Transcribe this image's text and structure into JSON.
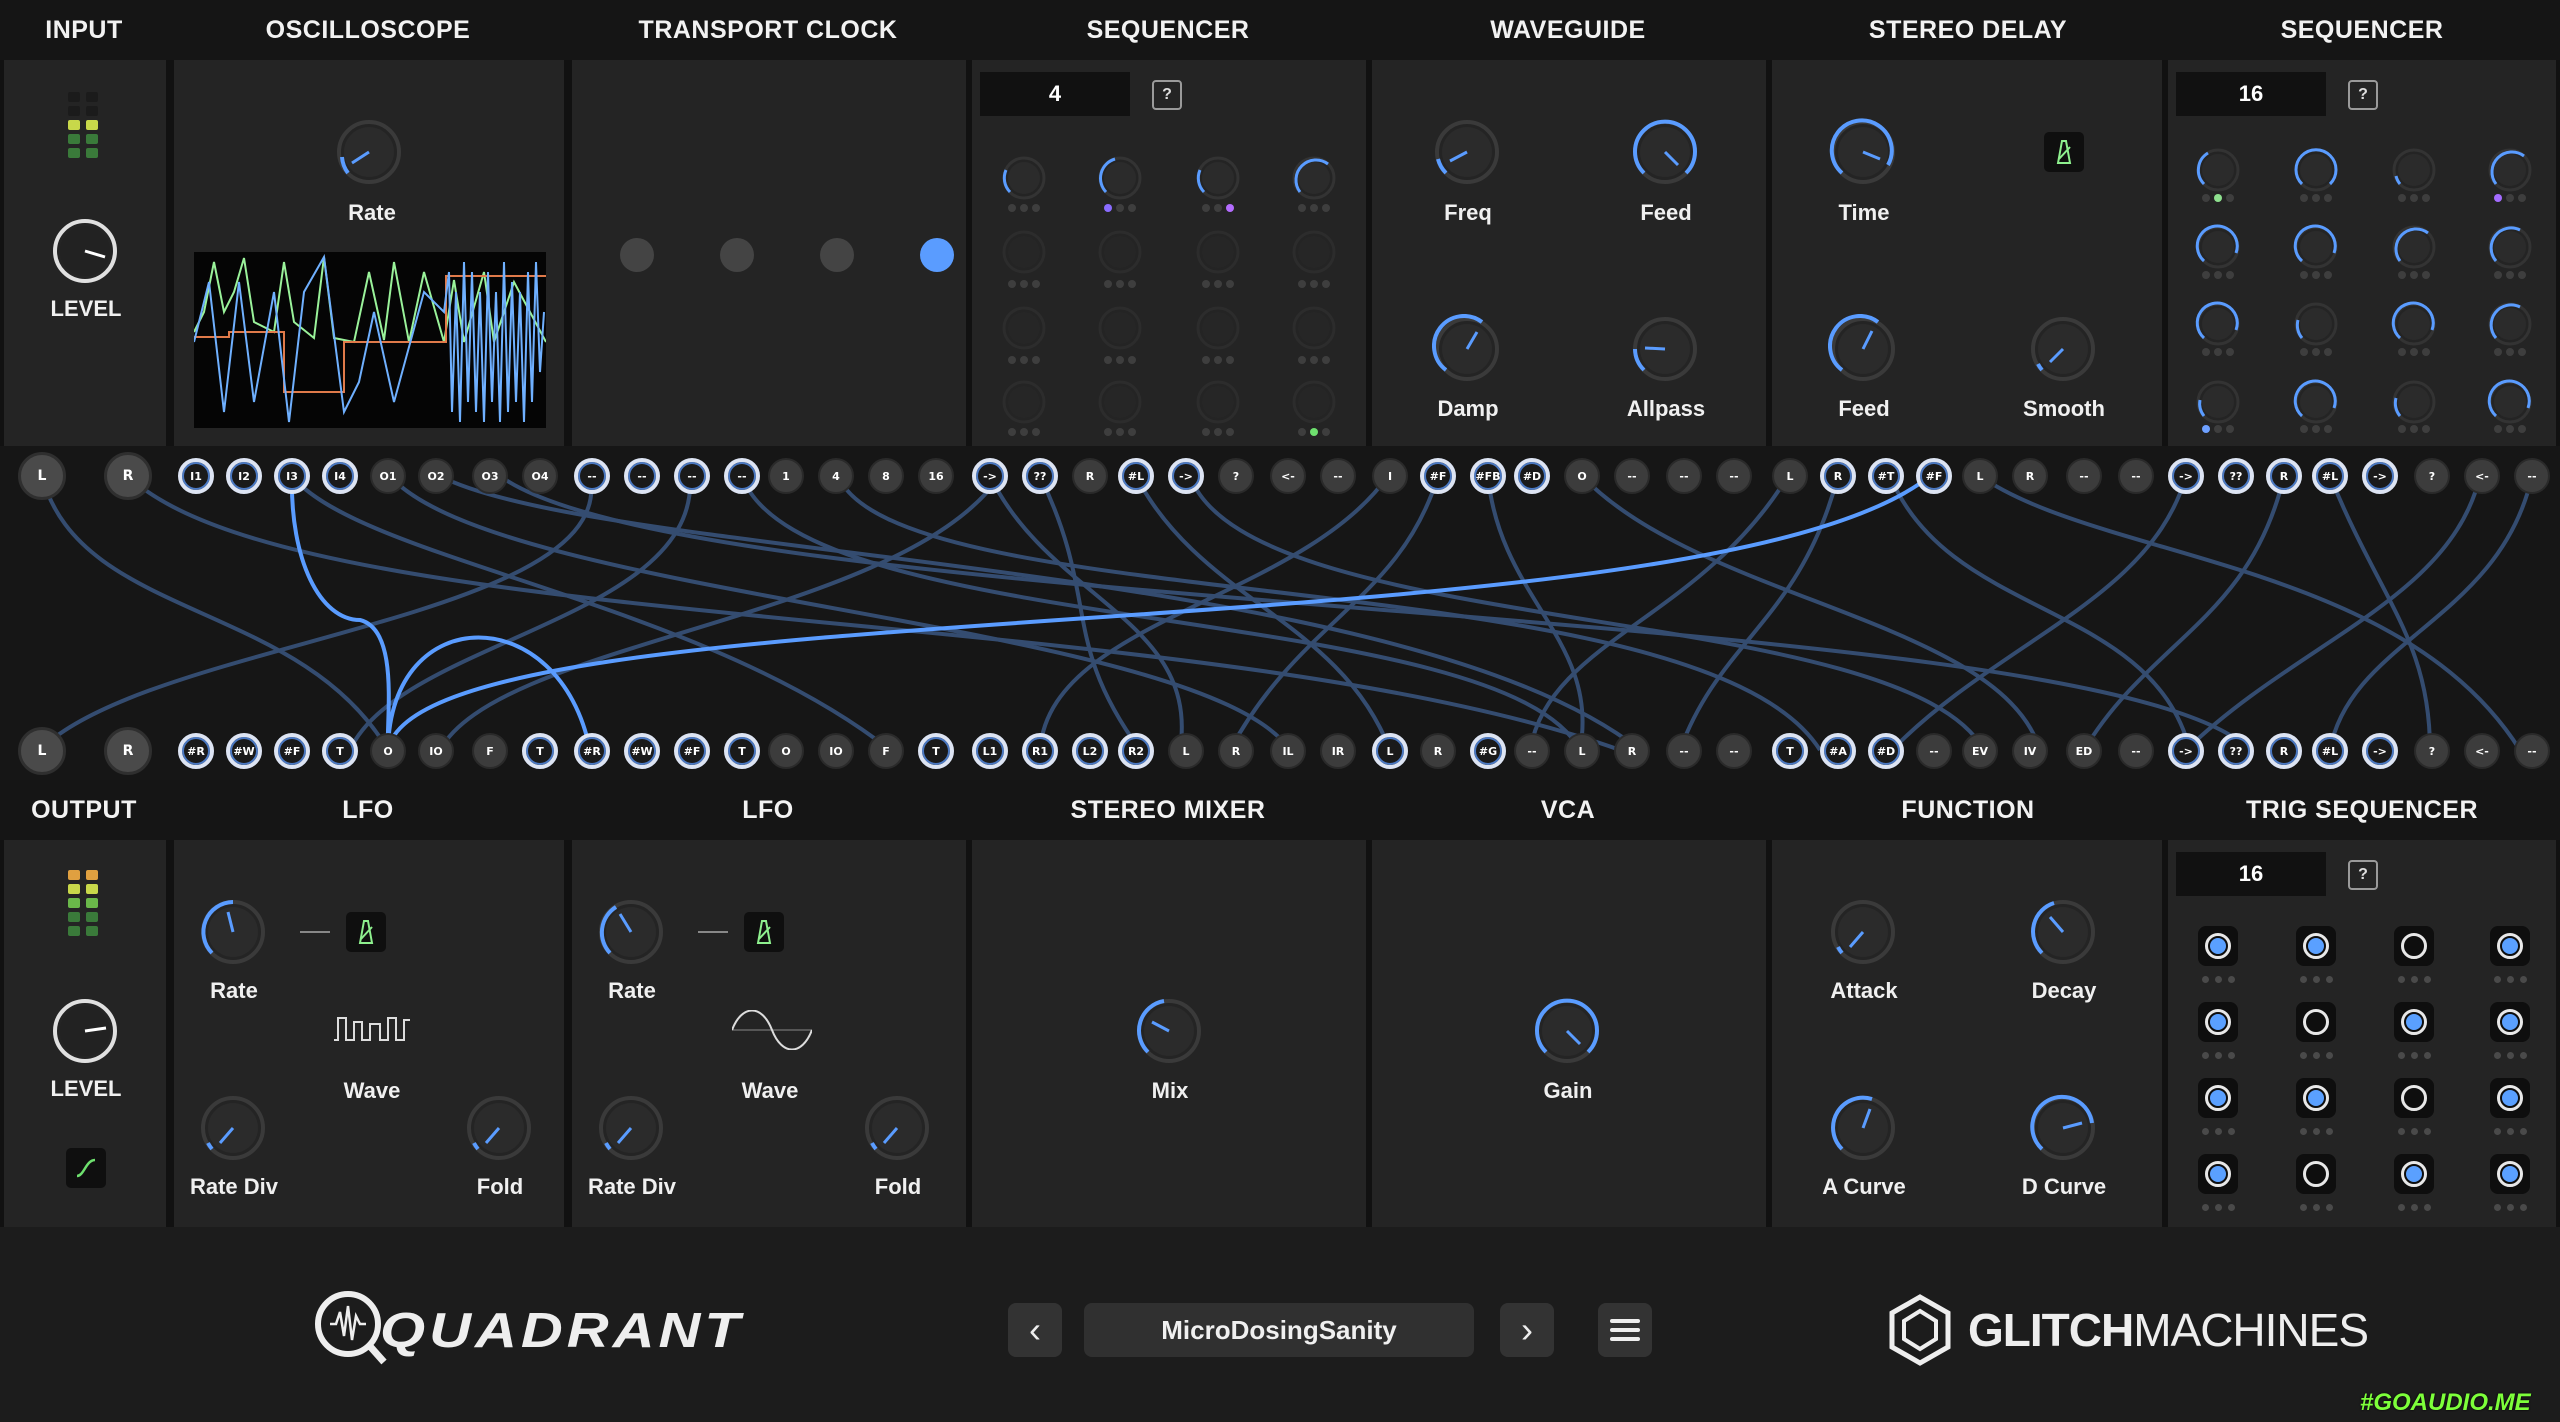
{
  "top_modules": [
    "INPUT",
    "OSCILLOSCOPE",
    "TRANSPORT CLOCK",
    "SEQUENCER",
    "WAVEGUIDE",
    "STEREO DELAY",
    "SEQUENCER"
  ],
  "bottom_modules": [
    "OUTPUT",
    "LFO",
    "LFO",
    "STEREO MIXER",
    "VCA",
    "FUNCTION",
    "TRIG SEQUENCER"
  ],
  "input": {
    "level_label": "LEVEL"
  },
  "output": {
    "level_label": "LEVEL"
  },
  "oscilloscope": {
    "rate_label": "Rate"
  },
  "sequencer1": {
    "steps": "4",
    "help": "?"
  },
  "sequencer2": {
    "steps": "16",
    "help": "?"
  },
  "trig_sequencer": {
    "steps": "16",
    "help": "?"
  },
  "waveguide": {
    "knobs": [
      "Freq",
      "Feed",
      "Damp",
      "Allpass"
    ]
  },
  "stereo_delay": {
    "knobs": [
      "Time",
      "Feed",
      "Smooth"
    ]
  },
  "lfo1": {
    "rate": "Rate",
    "wave": "Wave",
    "rate_div": "Rate Div",
    "fold": "Fold"
  },
  "lfo2": {
    "rate": "Rate",
    "wave": "Wave",
    "rate_div": "Rate Div",
    "fold": "Fold"
  },
  "stereo_mixer": {
    "mix": "Mix"
  },
  "vca": {
    "gain": "Gain"
  },
  "function": {
    "attack": "Attack",
    "decay": "Decay",
    "a_curve": "A Curve",
    "d_curve": "D Curve"
  },
  "top_jacks": [
    "L",
    "R",
    "I1",
    "I2",
    "I3",
    "I4",
    "O1",
    "O2",
    "O3",
    "O4",
    "--",
    "--",
    "--",
    "--",
    "1",
    "4",
    "8",
    "16",
    "->",
    "??",
    "R",
    "#L",
    "->",
    "?",
    "<-",
    "--",
    "I",
    "#F",
    "#FB",
    "#D",
    "O",
    "--",
    "--",
    "--",
    "L",
    "R",
    "#T",
    "#F",
    "L",
    "R",
    "--",
    "--",
    "->",
    "??",
    "R",
    "#L",
    "->",
    "?",
    "<-",
    "--"
  ],
  "bottom_jacks": [
    "L",
    "R",
    "#R",
    "#W",
    "#F",
    "T",
    "O",
    "IO",
    "F",
    "T",
    "#R",
    "#W",
    "#F",
    "T",
    "O",
    "IO",
    "F",
    "T",
    "L1",
    "R1",
    "L2",
    "R2",
    "L",
    "R",
    "IL",
    "IR",
    "L",
    "R",
    "#G",
    "--",
    "L",
    "R",
    "--",
    "--",
    "T",
    "#A",
    "#D",
    "--",
    "EV",
    "IV",
    "ED",
    "--",
    "->",
    "??",
    "R",
    "#L",
    "->",
    "?",
    "<-",
    "--"
  ],
  "footer": {
    "brand_left": "QUADRANT",
    "preset_name": "MicroDosingSanity",
    "brand_right_bold": "GLITCH",
    "brand_right_light": "MACHINES",
    "prev": "‹",
    "next": "›"
  },
  "watermark": "#GOAUDIO.ME",
  "colors": {
    "accent": "#5a9cff",
    "panel": "#242424",
    "bg": "#151515",
    "cable": "#4f7fbf"
  }
}
